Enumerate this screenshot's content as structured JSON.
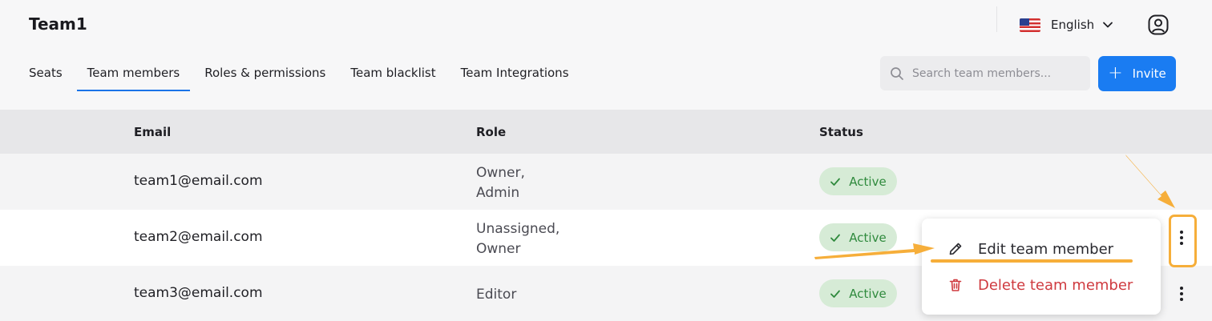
{
  "header": {
    "team_name": "Team1",
    "language": "English"
  },
  "tabs": [
    {
      "label": "Seats"
    },
    {
      "label": "Team members"
    },
    {
      "label": "Roles & permissions"
    },
    {
      "label": "Team blacklist"
    },
    {
      "label": "Team Integrations"
    }
  ],
  "active_tab": "Team members",
  "search": {
    "placeholder": "Search team members..."
  },
  "invite_label": "Invite",
  "table": {
    "columns": [
      "Email",
      "Role",
      "Status"
    ],
    "rows": [
      {
        "email": "team1@email.com",
        "role_line1": "Owner,",
        "role_line2": "Admin",
        "status": "Active"
      },
      {
        "email": "team2@email.com",
        "role_line1": "Unassigned,",
        "role_line2": "Owner",
        "status": "Active"
      },
      {
        "email": "team3@email.com",
        "role_line1": "Editor",
        "role_line2": "",
        "status": "Active"
      }
    ]
  },
  "context_menu": {
    "edit_label": "Edit team member",
    "delete_label": "Delete team member"
  },
  "colors": {
    "accent": "#1a7cf2",
    "status_active_bg": "#d6ebd6",
    "status_active_text": "#2f8a3d",
    "danger": "#cf3a3f",
    "annotation": "#f6ae3a"
  },
  "icons": [
    "us-flag-icon",
    "chevron-down-icon",
    "account-icon",
    "search-icon",
    "plus-icon",
    "check-icon",
    "kebab-menu-icon",
    "edit-pencil-icon",
    "trash-icon"
  ]
}
